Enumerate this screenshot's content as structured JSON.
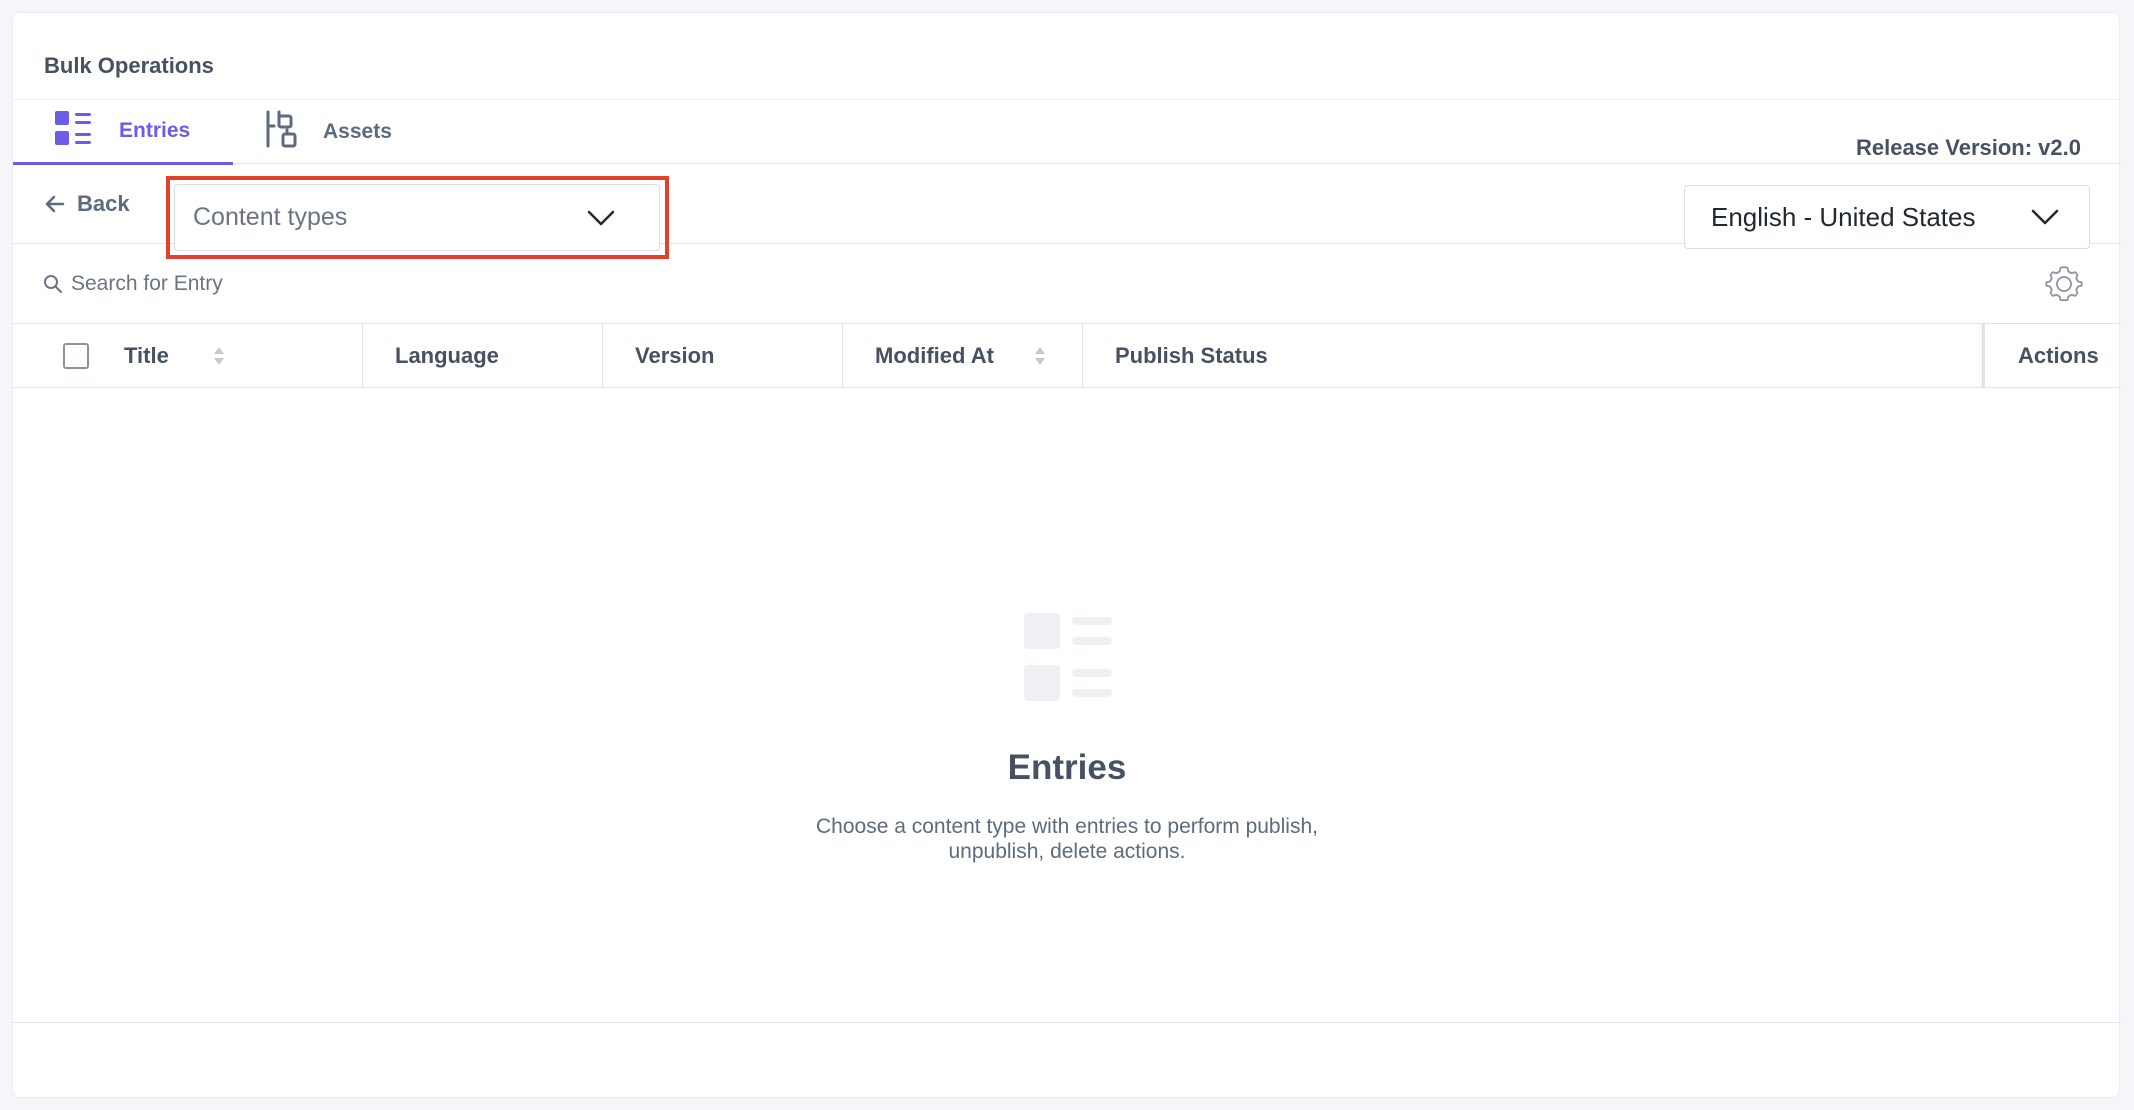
{
  "app": {
    "title": "Bulk Operations",
    "release_version": "Release Version: v2.0"
  },
  "tabs": [
    {
      "label": "Entries",
      "icon": "list-icon",
      "active": true
    },
    {
      "label": "Assets",
      "icon": "assets-icon",
      "active": false
    }
  ],
  "toolbar": {
    "back_label": "Back",
    "content_type_select": {
      "value": "Content types"
    },
    "language_select": {
      "value": "English - United States"
    }
  },
  "search": {
    "placeholder": "Search for Entry"
  },
  "table": {
    "columns": [
      "Title",
      "Language",
      "Version",
      "Modified At",
      "Publish Status",
      "Actions"
    ]
  },
  "empty_state": {
    "title": "Entries",
    "description_line1": "Choose a content type with entries to perform publish,",
    "description_line2": "unpublish, delete actions."
  },
  "colors": {
    "accent": "#6c5ce7",
    "highlight": "#e2412c",
    "text": "#475161"
  }
}
